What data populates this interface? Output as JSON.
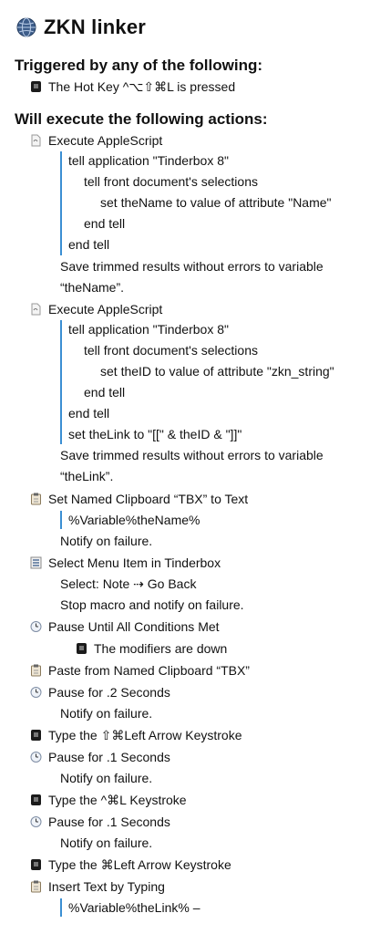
{
  "macro": {
    "title": "ZKN linker",
    "triggers_heading": "Triggered by any of the following:",
    "trigger": "The Hot Key ^⌥⇧⌘L is pressed",
    "actions_heading": "Will execute the following actions:"
  },
  "actions": {
    "a1": {
      "title": "Execute AppleScript",
      "code": [
        "tell application \"Tinderbox 8\"",
        "tell front document's selections",
        "set theName to value of attribute \"Name\"",
        "end tell",
        "end tell"
      ],
      "save_line1": "Save trimmed results without errors to variable",
      "save_line2": "“theName”."
    },
    "a2": {
      "title": "Execute AppleScript",
      "code": [
        "tell application \"Tinderbox 8\"",
        "tell front document's selections",
        "set theID to value of attribute \"zkn_string\"",
        "end tell",
        "end tell",
        "set theLink to \"[[\" & theID & \"]]\""
      ],
      "save_line1": "Save trimmed results without errors to variable",
      "save_line2": "“theLink”."
    },
    "a3": {
      "title": "Set Named Clipboard “TBX” to Text",
      "value": "%Variable%theName%",
      "note": "Notify on failure."
    },
    "a4": {
      "title": "Select Menu Item in Tinderbox",
      "select": "Select: Note ⇢ Go Back",
      "note": "Stop macro and notify on failure."
    },
    "a5": {
      "title": "Pause Until All Conditions Met",
      "condition": "The modifiers are down"
    },
    "a6": {
      "title": "Paste from Named Clipboard “TBX”"
    },
    "a7": {
      "title": "Pause for .2 Seconds",
      "note": "Notify on failure."
    },
    "a8": {
      "title": "Type the ⇧⌘Left Arrow Keystroke"
    },
    "a9": {
      "title": "Pause for .1 Seconds",
      "note": "Notify on failure."
    },
    "a10": {
      "title": "Type the ^⌘L Keystroke"
    },
    "a11": {
      "title": "Pause for .1 Seconds",
      "note": "Notify on failure."
    },
    "a12": {
      "title": "Type the ⌘Left Arrow Keystroke"
    },
    "a13": {
      "title": "Insert Text by Typing",
      "value": "%Variable%theLink% –"
    }
  },
  "icons": {
    "globe": "globe-icon",
    "keyboard": "keyboard-icon",
    "script": "applescript-icon",
    "clipboard": "clipboard-icon",
    "menu": "menu-icon",
    "pause": "pause-clock-icon"
  },
  "colors": {
    "accent_bar": "#3b8fd3"
  }
}
